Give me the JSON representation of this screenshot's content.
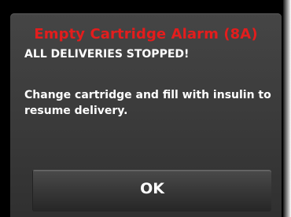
{
  "alarm": {
    "title": "Empty Cartridge Alarm (8A)",
    "subtitle": "ALL DELIVERIES STOPPED!",
    "message": "Change cartridge and fill with insulin to resume delivery."
  },
  "actions": {
    "ok_label": "OK"
  },
  "colors": {
    "alarm_title": "#e31d1d",
    "text": "#ffffff",
    "panel": "#3e3e3e",
    "background": "#000000"
  }
}
